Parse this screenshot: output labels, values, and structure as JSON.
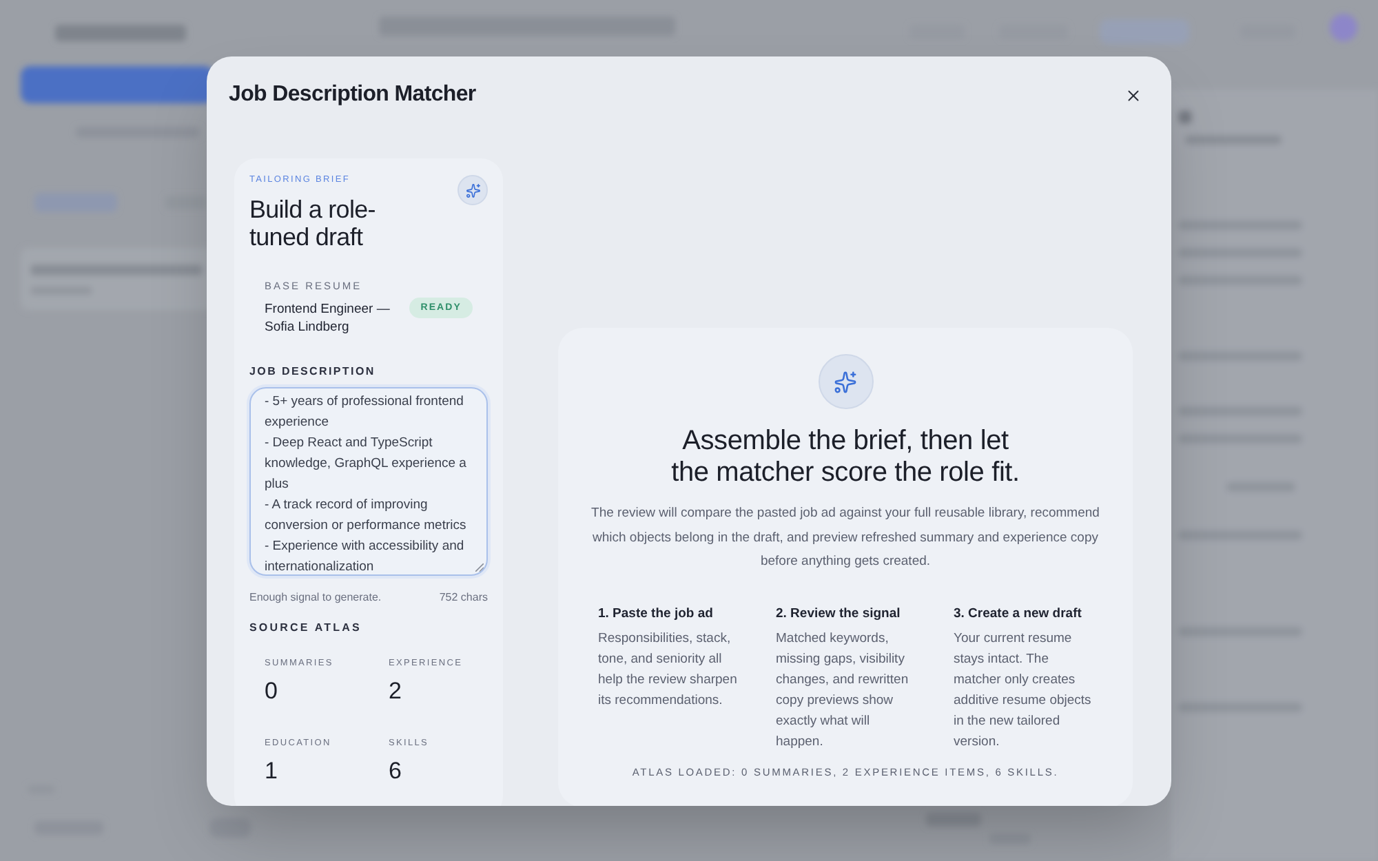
{
  "dialog": {
    "title": "Job Description Matcher"
  },
  "brief": {
    "eyebrow": "TAILORING BRIEF",
    "title": "Build a role-tuned draft",
    "base_resume": {
      "label": "BASE RESUME",
      "name": "Frontend Engineer — Sofia Lindberg",
      "status": "READY"
    },
    "job_description": {
      "label": "JOB DESCRIPTION",
      "value": "- 5+ years of professional frontend experience\n- Deep React and TypeScript knowledge, GraphQL experience a plus\n- A track record of improving conversion or performance metrics\n- Experience with accessibility and internationalization",
      "hint": "Enough signal to generate.",
      "count": "752 chars"
    },
    "atlas": {
      "label": "SOURCE ATLAS",
      "stats": [
        {
          "label": "SUMMARIES",
          "value": "0"
        },
        {
          "label": "EXPERIENCE",
          "value": "2"
        },
        {
          "label": "EDUCATION",
          "value": "1"
        },
        {
          "label": "SKILLS",
          "value": "6"
        }
      ]
    }
  },
  "overview": {
    "heading": "Assemble the brief, then let the matcher score the role fit.",
    "description": "The review will compare the pasted job ad against your full reusable library, recommend which objects belong in the draft, and preview refreshed summary and experience copy before anything gets created.",
    "steps": [
      {
        "title": "1. Paste the job ad",
        "body": "Responsibilities, stack, tone, and seniority all help the review sharpen its recommendations."
      },
      {
        "title": "2. Review the signal",
        "body": "Matched keywords, missing gaps, visibility changes, and rewritten copy previews show exactly what will happen."
      },
      {
        "title": "3. Create a new draft",
        "body": "Your current resume stays intact. The matcher only creates additive resume objects in the new tailored version."
      }
    ],
    "footer": "ATLAS LOADED: 0 SUMMARIES, 2 EXPERIENCE ITEMS, 6 SKILLS."
  }
}
